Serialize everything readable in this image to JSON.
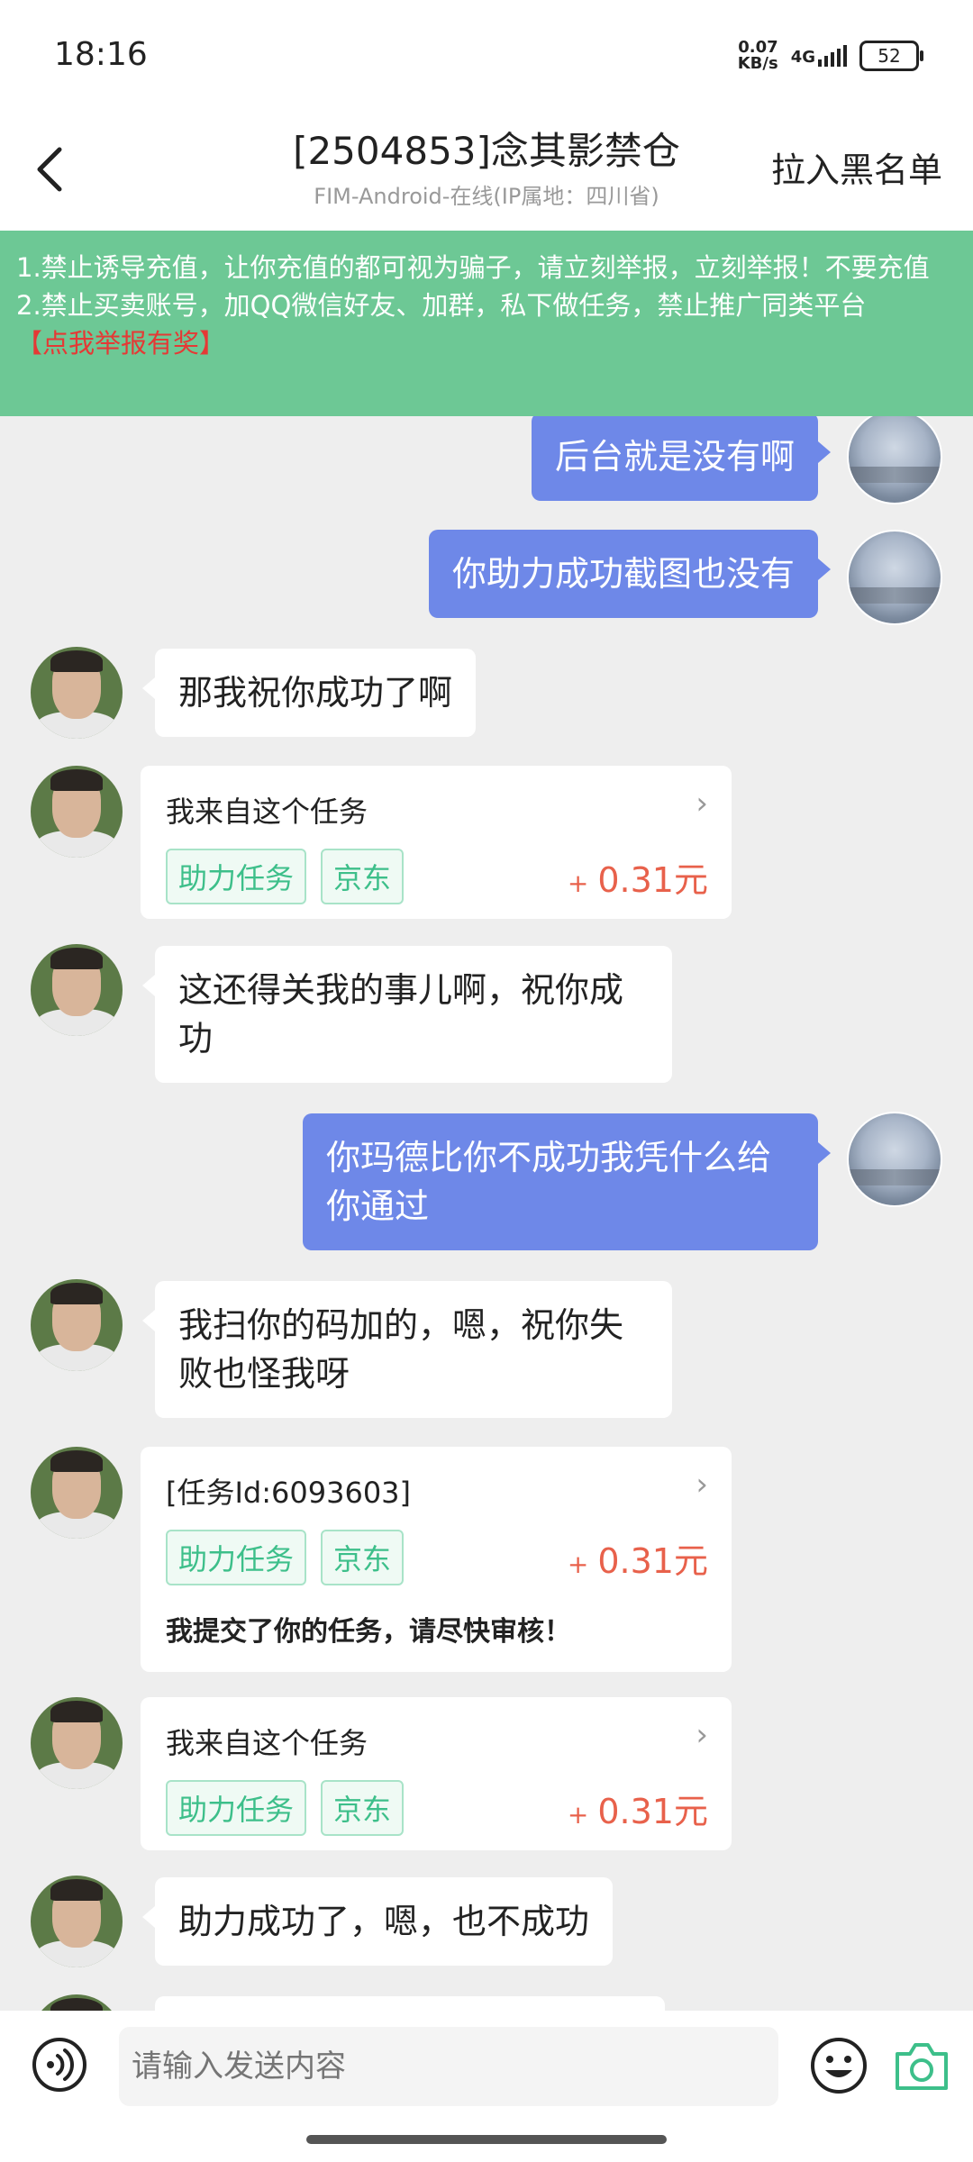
{
  "status": {
    "time": "18:16",
    "net_speed_value": "0.07",
    "net_speed_unit": "KB/s",
    "network": "4G",
    "battery": "52"
  },
  "header": {
    "title": "[2504853]念其影禁仓",
    "subtitle": "FIM-Android-在线(IP属地：四川省)",
    "action": "拉入黑名单"
  },
  "notice": {
    "line1": "1.禁止诱导充值，让你充值的都可视为骗子，请立刻举报，立刻举报！不要充值",
    "line2": "2.禁止买卖账号，加QQ微信好友、加群，私下做任务，禁止推广同类平台",
    "link": "【点我举报有奖】"
  },
  "messages": [
    {
      "side": "right",
      "text": "后台就是没有啊"
    },
    {
      "side": "right",
      "text": "你助力成功截图也没有"
    },
    {
      "side": "left",
      "text": "那我祝你成功了啊"
    },
    {
      "side": "left",
      "type": "task",
      "title": "我来自这个任务",
      "tags": [
        "助力任务",
        "京东"
      ],
      "price": "0.31元"
    },
    {
      "side": "left",
      "text": "这还得关我的事儿啊，祝你成功"
    },
    {
      "side": "right",
      "text": "你玛德比你不成功我凭什么给你通过"
    },
    {
      "side": "left",
      "text": "我扫你的码加的，嗯，祝你失败也怪我呀"
    },
    {
      "side": "left",
      "type": "task",
      "title": "[任务Id:6093603]",
      "tags": [
        "助力任务",
        "京东"
      ],
      "price": "0.31元",
      "note": "我提交了你的任务，请尽快审核！"
    },
    {
      "side": "left",
      "type": "task",
      "title": "我来自这个任务",
      "tags": [
        "助力任务",
        "京东"
      ],
      "price": "0.31元"
    },
    {
      "side": "left",
      "text": "助力成功了，嗯，也不成功"
    }
  ],
  "price_prefix": "+",
  "input": {
    "placeholder": "请输入发送内容"
  },
  "colors": {
    "notice_bg": "#6dc895",
    "my_bubble": "#6e88e8",
    "price": "#e8614b",
    "tag": "#3dbf8a"
  }
}
